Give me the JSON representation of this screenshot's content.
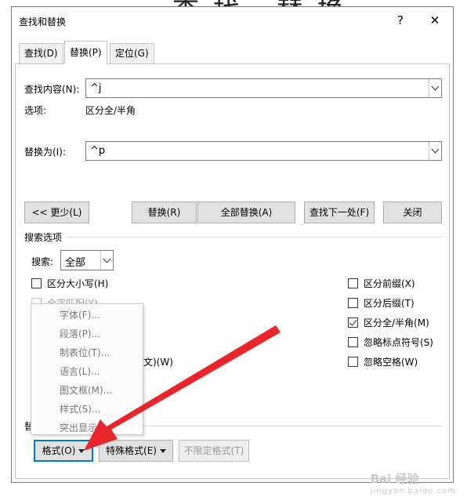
{
  "dialog": {
    "title": "查找和替换",
    "help_label": "?",
    "close_label": "✕"
  },
  "tabs": [
    {
      "label": "查找(D)",
      "active": false
    },
    {
      "label": "替换(P)",
      "active": true
    },
    {
      "label": "定位(G)",
      "active": false
    }
  ],
  "find": {
    "label": "查找内容(N):",
    "value": "^j",
    "options_label": "选项:",
    "options_value": "区分全/半角"
  },
  "replace": {
    "label": "替换为(I):",
    "value": "^p"
  },
  "buttons": {
    "less": "<< 更少(L)",
    "replace": "替换(R)",
    "replace_all": "全部替换(A)",
    "find_next": "查找下一处(F)",
    "close": "关闭"
  },
  "search_options": {
    "section_label": "搜索选项",
    "search_label": "搜索:",
    "search_value": "全部",
    "left_checks": [
      {
        "label": "区分大小写(H)",
        "checked": false,
        "disabled": false
      },
      {
        "label": "全字匹配(Y)",
        "checked": false,
        "disabled": true
      }
    ],
    "partial_visible": "文)(W)",
    "right_checks": [
      {
        "label": "区分前缀(X)",
        "checked": false
      },
      {
        "label": "区分后缀(T)",
        "checked": false
      },
      {
        "label": "区分全/半角(M)",
        "checked": true
      },
      {
        "label": "忽略标点符号(S)",
        "checked": false
      },
      {
        "label": "忽略空格(W)",
        "checked": false
      }
    ]
  },
  "format_menu": {
    "items": [
      "字体(F)...",
      "段落(P)...",
      "制表位(T)...",
      "语言(L)...",
      "图文框(M)...",
      "样式(S)...",
      "突出显示"
    ]
  },
  "replace_section": {
    "label_partial": "替"
  },
  "bottom_buttons": {
    "format": "格式(O)",
    "special": "特殊格式(E)",
    "no_format": "不限定格式(T)"
  },
  "watermark": {
    "title": "Bai 经验",
    "subtitle": "jingyan.baidu.com"
  },
  "colors": {
    "focus_blue": "#0078d7",
    "arrow_red": "#e8252b"
  }
}
